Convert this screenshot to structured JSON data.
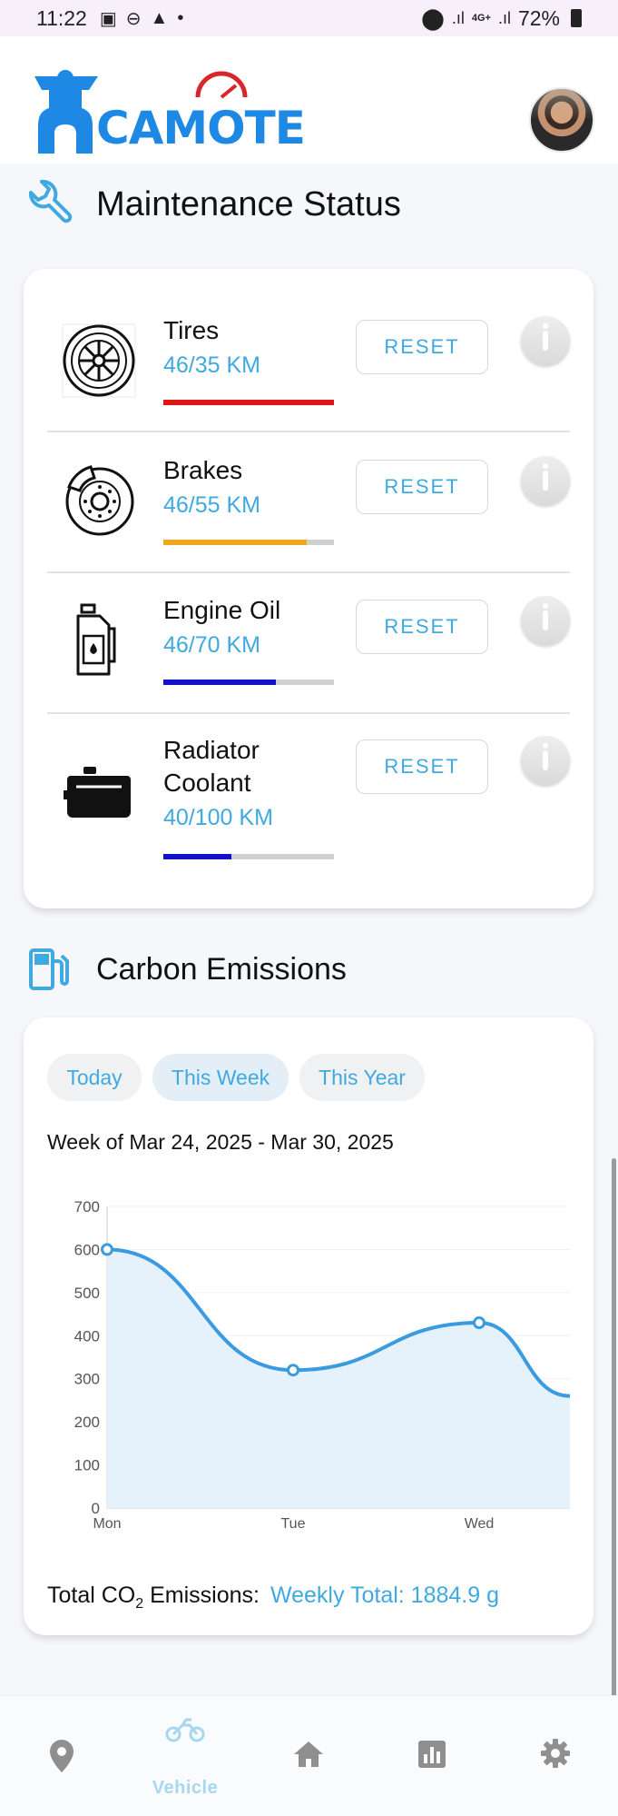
{
  "status_bar": {
    "time": "11:22",
    "battery": "72%",
    "network": "4G+"
  },
  "header": {
    "logo_text": "CAMOTE"
  },
  "maintenance": {
    "title": "Maintenance Status",
    "items": [
      {
        "name": "Tires",
        "km": "46/35 KM",
        "progress": 1.0,
        "bar_color": "#e01515",
        "reset_label": "RESET"
      },
      {
        "name": "Brakes",
        "km": "46/55 KM",
        "progress": 0.84,
        "bar_color": "#f2a81d",
        "reset_label": "RESET"
      },
      {
        "name": "Engine Oil",
        "km": "46/70 KM",
        "progress": 0.66,
        "bar_color": "#1212c8",
        "reset_label": "RESET"
      },
      {
        "name": "Radiator\nCoolant",
        "km": "40/100 KM",
        "progress": 0.4,
        "bar_color": "#1212c8",
        "reset_label": "RESET"
      }
    ]
  },
  "emissions": {
    "title": "Carbon Emissions",
    "tabs": [
      "Today",
      "This Week",
      "This Year"
    ],
    "active_tab": "This Week",
    "week_label": "Week of Mar 24, 2025 - Mar 30, 2025",
    "total_label": "Total CO",
    "total_label_sub": "2",
    "total_label_end": " Emissions:",
    "total_value": "Weekly Total: 1884.9 g"
  },
  "chart_data": {
    "type": "area",
    "categories": [
      "Mon",
      "Tue",
      "Wed"
    ],
    "values": [
      600,
      320,
      430
    ],
    "trailing_value": 260,
    "yticks": [
      0,
      100,
      200,
      300,
      400,
      500,
      600,
      700
    ],
    "ylim": [
      0,
      700
    ],
    "line_color": "#3a9be0",
    "fill_color": "#e6f2fb",
    "grid": true
  },
  "bottom_nav": {
    "items": [
      {
        "id": "location",
        "label": ""
      },
      {
        "id": "vehicle",
        "label": "Vehicle"
      },
      {
        "id": "home",
        "label": ""
      },
      {
        "id": "stats",
        "label": ""
      },
      {
        "id": "settings",
        "label": ""
      }
    ],
    "active": "vehicle",
    "active_color": "#a7d7ee",
    "inactive_color": "#8f8f8f"
  }
}
